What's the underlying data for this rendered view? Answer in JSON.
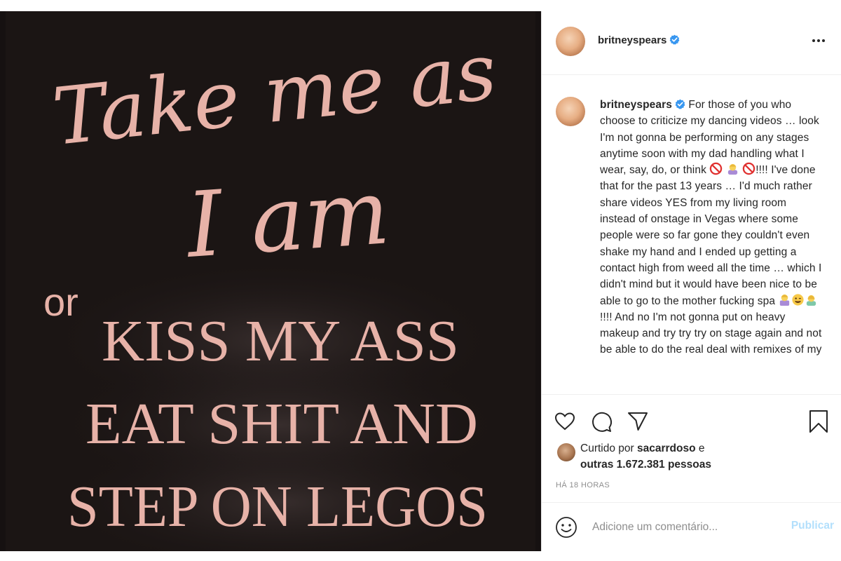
{
  "post": {
    "image_text": {
      "line1": "Take me as",
      "line2": "I am",
      "or": "or",
      "line3": "KISS MY ASS",
      "line4": "EAT SHIT AND",
      "line5": "STEP ON LEGOS"
    },
    "colors": {
      "background": "#161111",
      "text_pink": "#e7b2a8"
    }
  },
  "header": {
    "username": "britneyspears",
    "verified_icon": "verified-badge-icon",
    "more_icon": "more-options-icon"
  },
  "caption": {
    "username": "britneyspears",
    "part1": "For those of you who choose to criticize my dancing videos … look I'm not gonna be performing on any stages anytime soon with my dad handling what I wear, say, do, or think",
    "part2": "!!!! I've done that for the past 13 years … I'd much rather share videos YES from my living room instead of onstage in Vegas where some people were so far gone they couldn't even shake my hand and I ended up getting a contact high from weed all the time … which I didn't mind but it would have been nice to be able to go to the mother fucking spa",
    "part3": "!!!! And no I'm not gonna put on heavy makeup and try try try on stage again and not be able to do the real deal with remixes of my"
  },
  "actions": {
    "like_icon": "heart-icon",
    "comment_icon": "comment-icon",
    "share_icon": "paper-plane-icon",
    "save_icon": "bookmark-icon"
  },
  "likes": {
    "prefix": "Curtido por",
    "user": "sacarrdoso",
    "suffix": "e",
    "others_count": "outras 1.672.381 pessoas"
  },
  "timestamp": "HÁ 18 HORAS",
  "comment": {
    "placeholder": "Adicione um comentário...",
    "publish_label": "Publicar"
  },
  "colors": {
    "verified_blue": "#3897f0",
    "publish_disabled": "#b2dffc",
    "secondary_text": "#8e8e8e"
  }
}
